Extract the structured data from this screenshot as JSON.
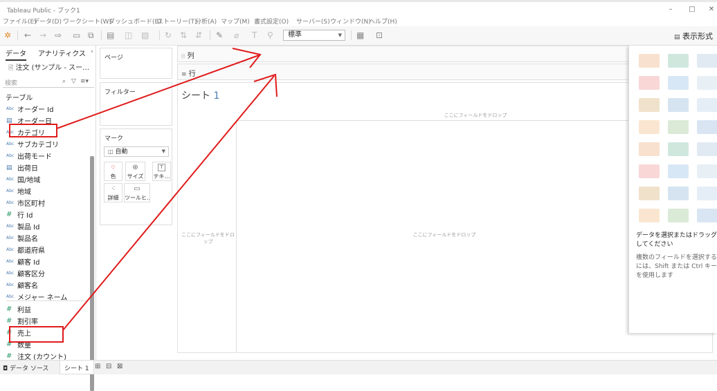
{
  "window": {
    "title": "Tableau Public - ブック1"
  },
  "menu": [
    "ファイル(E)",
    "データ(D)",
    "ワークシート(W)",
    "ダッシュボード(B)",
    "ストーリー(T)",
    "分析(A)",
    "マップ(M)",
    "書式設定(O)",
    "サーバー(S)",
    "ウィンドウ(N)",
    "ヘルプ(H)"
  ],
  "toolbar": {
    "fit_value": "標準",
    "show_me_label": "表示形式"
  },
  "data_pane": {
    "tabs": [
      "データ",
      "アナリティクス"
    ],
    "datasource": "注文 (サンプル - スー…",
    "search_placeholder": "検索",
    "table_header": "テーブル",
    "dimensions": [
      {
        "type": "Abc",
        "name": "オーダー Id"
      },
      {
        "type": "cal",
        "name": "オーダー日"
      },
      {
        "type": "Abc",
        "name": "カテゴリ"
      },
      {
        "type": "Abc",
        "name": "サブカテゴリ"
      },
      {
        "type": "Abc",
        "name": "出荷モード"
      },
      {
        "type": "cal",
        "name": "出荷日"
      },
      {
        "type": "Abc",
        "name": "国/地域"
      },
      {
        "type": "Abc",
        "name": "地域"
      },
      {
        "type": "Abc",
        "name": "市区町村"
      },
      {
        "type": "#",
        "name": "行 Id"
      },
      {
        "type": "Abc",
        "name": "製品 Id"
      },
      {
        "type": "Abc",
        "name": "製品名"
      },
      {
        "type": "Abc",
        "name": "都道府県"
      },
      {
        "type": "Abc",
        "name": "顧客 Id"
      },
      {
        "type": "Abc",
        "name": "顧客区分"
      },
      {
        "type": "Abc",
        "name": "顧客名"
      },
      {
        "type": "Abc",
        "name": "メジャー ネーム"
      }
    ],
    "measures": [
      {
        "type": "#",
        "name": "利益"
      },
      {
        "type": "#",
        "name": "割引率"
      },
      {
        "type": "#",
        "name": "売上"
      },
      {
        "type": "#",
        "name": "数量"
      },
      {
        "type": "#",
        "name": "注文 (カウント)"
      }
    ]
  },
  "cards": {
    "pages": "ページ",
    "filters": "フィルター",
    "marks": "マーク",
    "marks_type": "自動",
    "mark_buttons": [
      "色",
      "サイズ",
      "テキ…",
      "詳細",
      "ツールヒ…"
    ]
  },
  "shelves": {
    "columns": "列",
    "rows": "行"
  },
  "view": {
    "sheet_title_prefix": "シート ",
    "sheet_title_number": "1",
    "drop_col": "ここにフィールドをドロップ",
    "drop_row": "ここにフィールドをドロップ",
    "drop_body": "ここにフィールドをドロップ"
  },
  "show_me": {
    "hint1": "データを選択またはドラッグしてください",
    "hint2": "複数のフィールドを選択するには、Shift または Ctrl キーを使用します"
  },
  "status": {
    "datasource_tab": "データ ソース",
    "sheet_tab": "シート 1"
  },
  "annotations": {
    "color": "#e01b1b"
  }
}
